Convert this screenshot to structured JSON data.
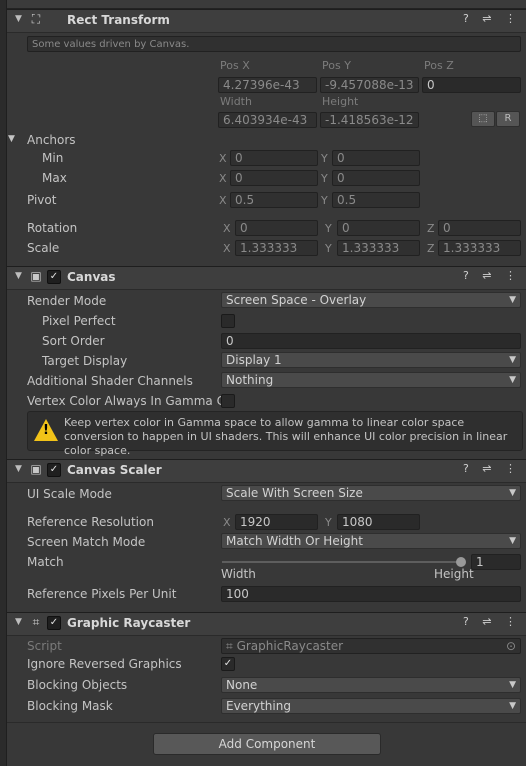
{
  "rect_transform": {
    "title": "Rect Transform",
    "driven_note": "Some values driven by Canvas.",
    "pos_x_label": "Pos X",
    "pos_y_label": "Pos Y",
    "pos_z_label": "Pos Z",
    "pos_x": "4.27396e-43",
    "pos_y": "-9.457088e-13",
    "pos_z": "0",
    "width_label": "Width",
    "height_label": "Height",
    "width": "6.403934e-43",
    "height": "-1.418563e-12",
    "raw_button": "R",
    "anchors_label": "Anchors",
    "min_label": "Min",
    "max_label": "Max",
    "min_x": "0",
    "min_y": "0",
    "max_x": "0",
    "max_y": "0",
    "pivot_label": "Pivot",
    "pivot_x": "0.5",
    "pivot_y": "0.5",
    "rotation_label": "Rotation",
    "rot_x": "0",
    "rot_y": "0",
    "rot_z": "0",
    "scale_label": "Scale",
    "scale_x": "1.333333",
    "scale_y": "1.333333",
    "scale_z": "1.333333",
    "axis_x": "X",
    "axis_y": "Y",
    "axis_z": "Z"
  },
  "canvas": {
    "title": "Canvas",
    "render_mode_label": "Render Mode",
    "render_mode": "Screen Space - Overlay",
    "pixel_perfect_label": "Pixel Perfect",
    "sort_order_label": "Sort Order",
    "sort_order": "0",
    "target_display_label": "Target Display",
    "target_display": "Display 1",
    "shader_channels_label": "Additional Shader Channels",
    "shader_channels": "Nothing",
    "vertex_color_label": "Vertex Color Always In Gamma Co",
    "warning": "Keep vertex color in Gamma space to allow gamma to linear color space conversion to happen in UI shaders. This will enhance UI color precision in linear color space."
  },
  "canvas_scaler": {
    "title": "Canvas Scaler",
    "ui_scale_mode_label": "UI Scale Mode",
    "ui_scale_mode": "Scale With Screen Size",
    "ref_res_label": "Reference Resolution",
    "ref_res_x": "1920",
    "ref_res_y": "1080",
    "match_mode_label": "Screen Match Mode",
    "match_mode": "Match Width Or Height",
    "match_label": "Match",
    "match_value": "1",
    "match_fraction": 1,
    "width_label": "Width",
    "height_label": "Height",
    "ref_ppu_label": "Reference Pixels Per Unit",
    "ref_ppu": "100"
  },
  "graphic_raycaster": {
    "title": "Graphic Raycaster",
    "script_label": "Script",
    "script_value": "GraphicRaycaster",
    "ignore_reversed_label": "Ignore Reversed Graphics",
    "blocking_objects_label": "Blocking Objects",
    "blocking_objects": "None",
    "blocking_mask_label": "Blocking Mask",
    "blocking_mask": "Everything"
  },
  "add_component": "Add Component",
  "icons": {
    "help": "?",
    "settings": "⇌",
    "more": "⋮"
  }
}
